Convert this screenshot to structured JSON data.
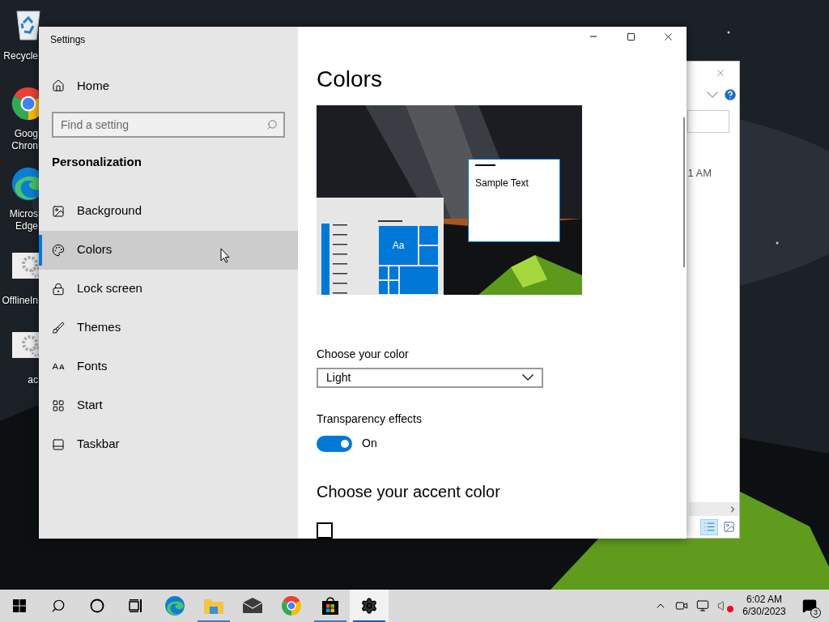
{
  "desktop": {
    "icons": [
      {
        "kind": "recycle-bin",
        "lines": [
          "Recycle"
        ]
      },
      {
        "kind": "chrome",
        "lines": [
          "Goog",
          "Chron"
        ]
      },
      {
        "kind": "edge",
        "lines": [
          "Micros",
          "Edge"
        ]
      },
      {
        "kind": "gear",
        "lines": [
          "OfflineIn"
        ]
      },
      {
        "kind": "gear",
        "lines": [
          "ac"
        ]
      }
    ]
  },
  "background_window": {
    "visible_text": "1 AM",
    "view_buttons": [
      {
        "kind": "details",
        "selected": true
      },
      {
        "kind": "preview",
        "selected": false
      }
    ]
  },
  "settings": {
    "title": "Settings",
    "home": "Home",
    "search": {
      "placeholder": "Find a setting"
    },
    "section": "Personalization",
    "nav": [
      {
        "kind": "background",
        "label": "Background",
        "selected": false
      },
      {
        "kind": "colors",
        "label": "Colors",
        "selected": true
      },
      {
        "kind": "lock",
        "label": "Lock screen",
        "selected": false
      },
      {
        "kind": "themes",
        "label": "Themes",
        "selected": false
      },
      {
        "kind": "fonts",
        "label": "Fonts",
        "selected": false
      },
      {
        "kind": "start",
        "label": "Start",
        "selected": false
      },
      {
        "kind": "taskbar",
        "label": "Taskbar",
        "selected": false
      }
    ],
    "page_title": "Colors",
    "preview": {
      "sample_text": "Sample Text",
      "tile_label": "Aa"
    },
    "color_mode": {
      "label": "Choose your color",
      "value": "Light"
    },
    "transparency": {
      "label": "Transparency effects",
      "on": true,
      "state_label": "On"
    },
    "accent": {
      "title": "Choose your accent color",
      "auto_pick": {
        "checked": false
      }
    }
  },
  "taskbar": {
    "buttons": [
      {
        "kind": "start",
        "running": false,
        "selected": false
      },
      {
        "kind": "search",
        "running": false,
        "selected": false
      },
      {
        "kind": "cortana",
        "running": false,
        "selected": false
      },
      {
        "kind": "taskview",
        "running": false,
        "selected": false
      },
      {
        "kind": "edge",
        "running": false,
        "selected": false
      },
      {
        "kind": "explorer",
        "running": true,
        "selected": false
      },
      {
        "kind": "mail",
        "running": false,
        "selected": false
      },
      {
        "kind": "chrome",
        "running": false,
        "selected": false
      },
      {
        "kind": "store",
        "running": true,
        "selected": false
      },
      {
        "kind": "settings",
        "running": true,
        "selected": true
      }
    ],
    "volume": {
      "muted": true
    },
    "clock": {
      "time": "6:02 AM",
      "date": "6/30/2023"
    },
    "notifications": {
      "count": "3"
    }
  }
}
